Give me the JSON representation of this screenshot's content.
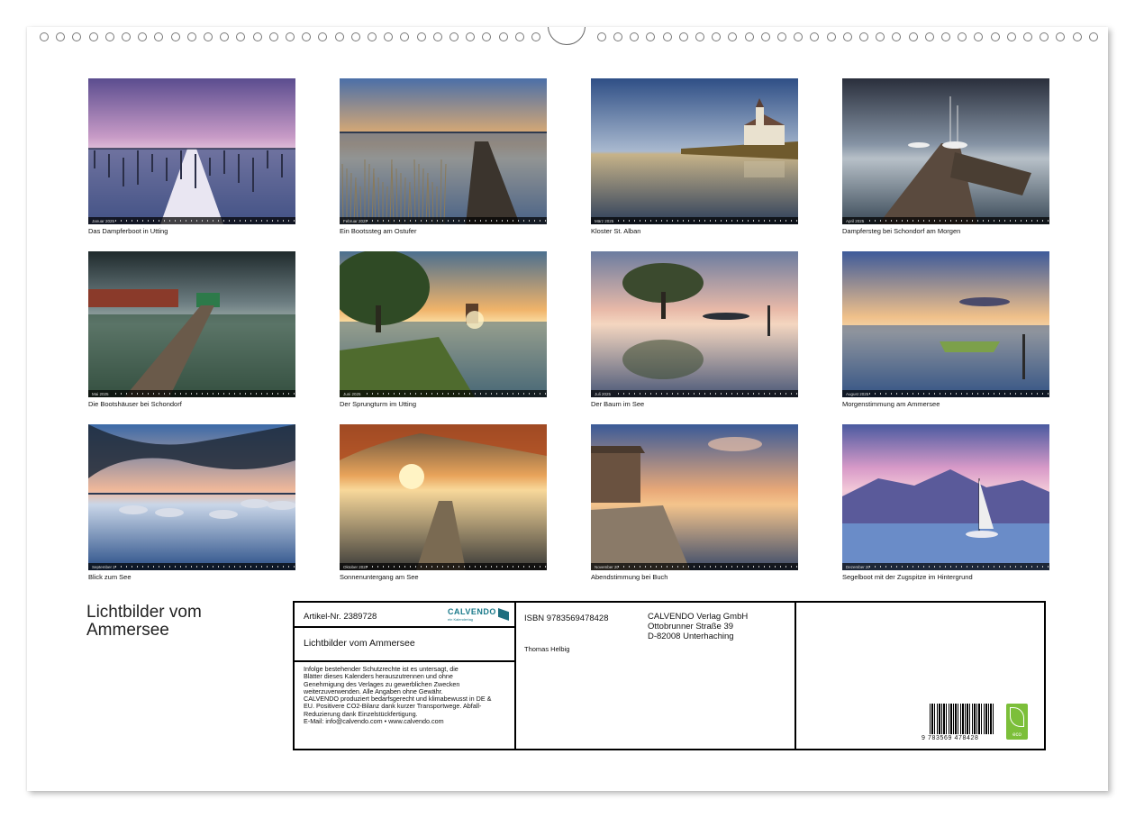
{
  "calendar": {
    "title": "Lichtbilder vom\nAmmersee"
  },
  "photos": [
    {
      "month": "Januar 2025",
      "caption": "Das Dampferboot in Utting",
      "scene": "winter-pier-dusk"
    },
    {
      "month": "Februar 2025",
      "caption": "Ein Bootssteg am Ostufer",
      "scene": "pier-reeds-sunset"
    },
    {
      "month": "März 2025",
      "caption": "Kloster St. Alban",
      "scene": "church-reflection"
    },
    {
      "month": "April 2025",
      "caption": "Dampfersteg bei Schondorf am Morgen",
      "scene": "dock-sailboats"
    },
    {
      "month": "Mai 2025",
      "caption": "Die Bootshäuser bei Schondorf",
      "scene": "boathouses-pier"
    },
    {
      "month": "Juni 2025",
      "caption": "Der Sprungturm im Utting",
      "scene": "diving-tower-sunset"
    },
    {
      "month": "Juli 2025",
      "caption": "Der Baum im See",
      "scene": "tree-in-lake"
    },
    {
      "month": "August 2025",
      "caption": "Morgenstimmung am Ammersee",
      "scene": "morning-boat"
    },
    {
      "month": "September 2025",
      "caption": "Blick zum See",
      "scene": "moored-boats-branches"
    },
    {
      "month": "Oktober 2025",
      "caption": "Sonnenuntergang am See",
      "scene": "autumn-sunset-pier"
    },
    {
      "month": "November 2025",
      "caption": "Abendstimmung bei Buch",
      "scene": "boathouse-shore"
    },
    {
      "month": "Dezember 2025",
      "caption": "Segelboot mit der Zugspitze im Hintergrund",
      "scene": "sailboat-mountains"
    }
  ],
  "info_box": {
    "article": "Artikel-Nr. 2389728",
    "brand": "CALVENDO",
    "brand_sub": "ein Kalendertag",
    "product_title": "Lichtbilder vom Ammersee",
    "legal_text": "Infolge bestehender Schutzrechte ist es untersagt, die\nBlätter dieses Kalenders herauszutrennen und ohne\nGenehmigung des Verlages zu gewerblichen Zwecken\nweiterzuverwenden. Alle Angaben ohne Gewähr.\nCALVENDO produziert bedarfsgerecht und klimabewusst in DE &\nEU. Positivere CO2-Bilanz dank kurzer Transportwege. Abfall-\nReduzierung dank Einzelstückfertigung.\nE-Mail: info@calvendo.com • www.calvendo.com",
    "isbn": "ISBN 9783569478428",
    "author": "Thomas Helbig",
    "publisher_name": "CALVENDO Verlag GmbH",
    "publisher_street": "Ottobrunner Straße 39",
    "publisher_city": "D-82008 Unterhaching",
    "barcode_number": "9 783569 478428",
    "eco_label": "eco"
  }
}
